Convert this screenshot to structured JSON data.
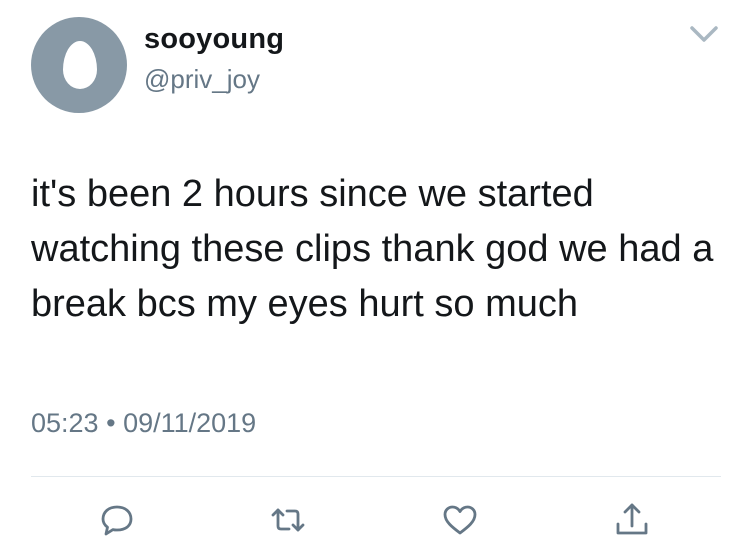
{
  "tweet": {
    "author": {
      "display_name": "sooyoung",
      "handle": "@priv_joy"
    },
    "text": "it's been 2 hours since we started watching these clips thank god we had a break bcs my eyes hurt so much",
    "time": "05:23",
    "separator": "•",
    "date": "09/11/2019"
  },
  "icons": {
    "menu": "chevron-down-icon",
    "reply": "reply-icon",
    "retweet": "retweet-icon",
    "like": "heart-icon",
    "share": "share-icon"
  },
  "colors": {
    "text": "#14171a",
    "secondary": "#657786",
    "avatar_bg": "#8899a6",
    "divider": "#e1e8ed"
  }
}
